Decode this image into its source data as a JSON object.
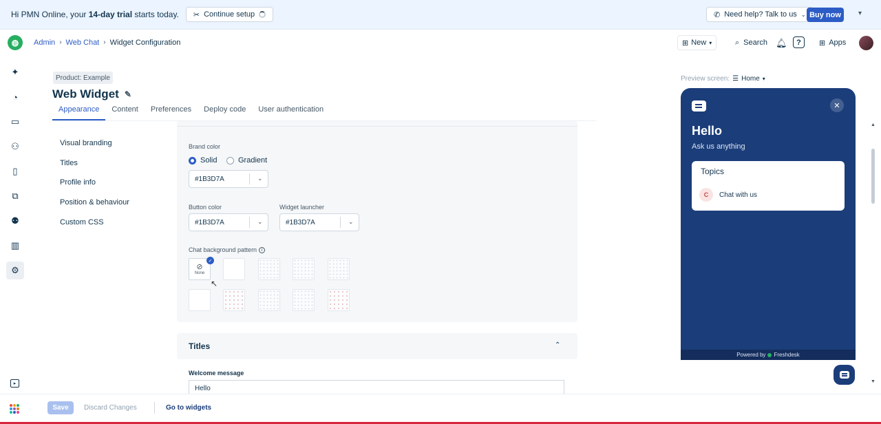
{
  "banner": {
    "greeting_prefix": "Hi PMN Online, your ",
    "trial_bold": "14-day trial",
    "greeting_suffix": " starts today.",
    "continue_label": "Continue setup",
    "help_label": "Need help? Talk to us",
    "buy_label": "Buy now"
  },
  "nav": {
    "breadcrumb": [
      "Admin",
      "Web Chat",
      "Widget Configuration"
    ],
    "new_label": "New",
    "search_label": "Search",
    "help_label": "?",
    "apps_label": "Apps"
  },
  "header": {
    "product_tag": "Product: Example",
    "title": "Web Widget",
    "tabs": [
      "Appearance",
      "Content",
      "Preferences",
      "Deploy code",
      "User authentication"
    ],
    "active_tab": "Appearance"
  },
  "section_nav": [
    "Visual branding",
    "Titles",
    "Profile info",
    "Position & behaviour",
    "Custom CSS"
  ],
  "branding": {
    "brand_color_label": "Brand color",
    "options": [
      "Solid",
      "Gradient"
    ],
    "selected_option": "Solid",
    "brand_color_value": "#1B3D7A",
    "button_color_label": "Button color",
    "button_color_value": "#1B3D7A",
    "widget_launcher_label": "Widget launcher",
    "widget_launcher_value": "#1B3D7A",
    "pattern_label": "Chat background pattern",
    "none_label": "None"
  },
  "titles": {
    "heading": "Titles",
    "welcome_label": "Welcome message",
    "welcome_value": "Hello"
  },
  "preview": {
    "screen_label": "Preview screen:",
    "screen_value": "Home",
    "hello": "Hello",
    "subtitle": "Ask us anything",
    "topics_title": "Topics",
    "topic_initial": "C",
    "topic_label": "Chat with us",
    "powered_prefix": "Powered by",
    "powered_brand": "Freshdesk"
  },
  "footer": {
    "save_label": "Save",
    "discard_label": "Discard Changes",
    "goto_label": "Go to widgets"
  },
  "colors": {
    "brand": "#1B3D7A",
    "accent": "#2c5cc5",
    "logo_green": "#27ae60"
  }
}
